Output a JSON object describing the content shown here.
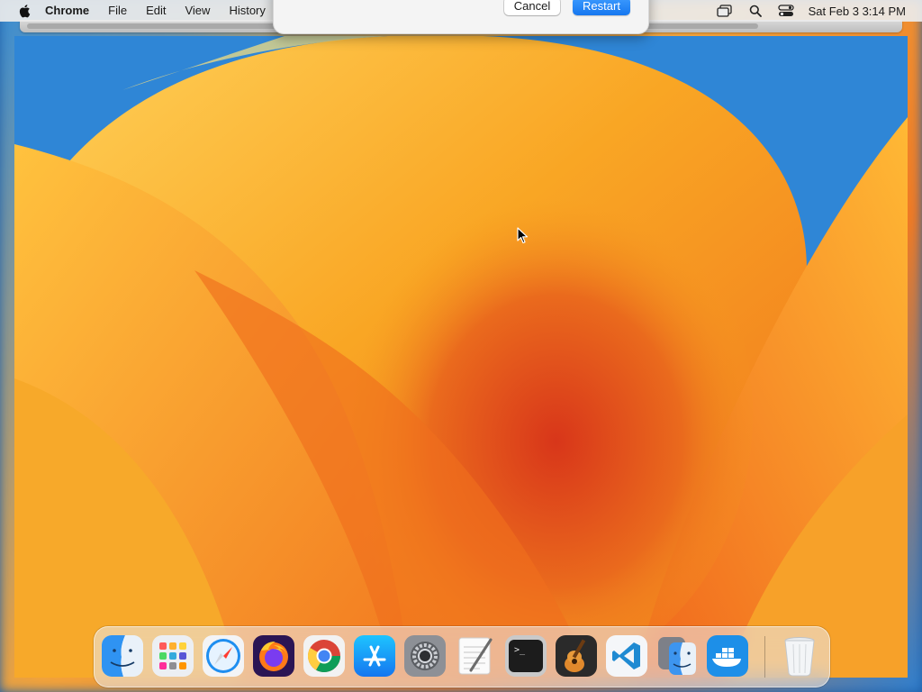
{
  "menubar": {
    "app_name": "Chrome",
    "menus": [
      "File",
      "Edit",
      "View",
      "History"
    ],
    "clock": "Sat Feb 3  3:14 PM"
  },
  "dialog": {
    "cancel_label": "Cancel",
    "restart_label": "Restart"
  },
  "dock": {
    "items": [
      {
        "name": "finder-icon"
      },
      {
        "name": "launchpad-icon"
      },
      {
        "name": "safari-icon"
      },
      {
        "name": "firefox-icon"
      },
      {
        "name": "chrome-icon"
      },
      {
        "name": "app-store-icon"
      },
      {
        "name": "system-settings-icon"
      },
      {
        "name": "textedit-icon"
      },
      {
        "name": "terminal-icon"
      },
      {
        "name": "garageband-icon"
      },
      {
        "name": "vscode-icon"
      },
      {
        "name": "migration-assistant-icon"
      },
      {
        "name": "docker-icon"
      },
      {
        "name": "trash-icon"
      }
    ]
  },
  "colors": {
    "accent": "#1677ef",
    "wallpaper_orange": "#f59a1e",
    "wallpaper_red": "#e04a1a",
    "wallpaper_blue": "#2f86d6"
  }
}
